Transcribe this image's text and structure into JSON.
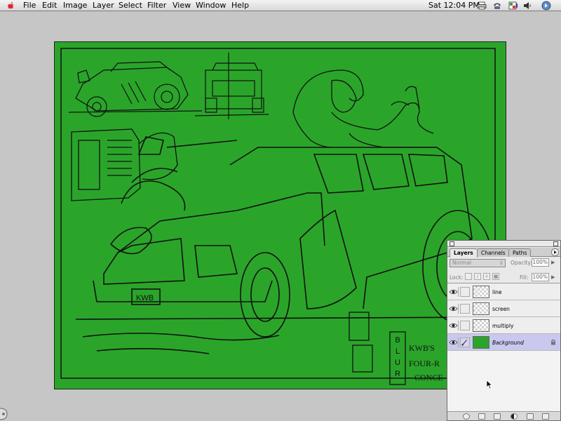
{
  "menubar": {
    "items": [
      "File",
      "Edit",
      "Image",
      "Layer",
      "Select",
      "Filter",
      "View",
      "Window",
      "Help"
    ],
    "clock": "Sat 12:04 PM",
    "icons": [
      "apple-logo-icon",
      "printer-icon",
      "phone-icon",
      "palette-icon",
      "speaker-icon",
      "photoshop-app-icon"
    ]
  },
  "canvas": {
    "background_color": "#2aa52a",
    "line_color": "#111111",
    "signature_text": "BLUR",
    "lettering": [
      "KWB'S",
      "FOUR-R",
      "CONCE"
    ],
    "plate_text": "KWB"
  },
  "layers_palette": {
    "tabs": [
      "Layers",
      "Channels",
      "Paths"
    ],
    "active_tab": "Layers",
    "blend_mode": "Normal",
    "opacity_label": "Opacity:",
    "opacity_value": "100%",
    "lock_label": "Lock:",
    "fill_label": "Fill:",
    "fill_value": "100%",
    "layers": [
      {
        "name": "line",
        "visible": true,
        "selected": false
      },
      {
        "name": "screen",
        "visible": true,
        "selected": false
      },
      {
        "name": "multiply",
        "visible": true,
        "selected": false
      },
      {
        "name": "Background",
        "visible": true,
        "selected": true,
        "locked": true
      }
    ],
    "bottom_buttons": [
      "layer-style-icon",
      "mask-icon",
      "new-set-icon",
      "adjustment-layer-icon",
      "new-layer-icon",
      "trash-icon"
    ]
  }
}
